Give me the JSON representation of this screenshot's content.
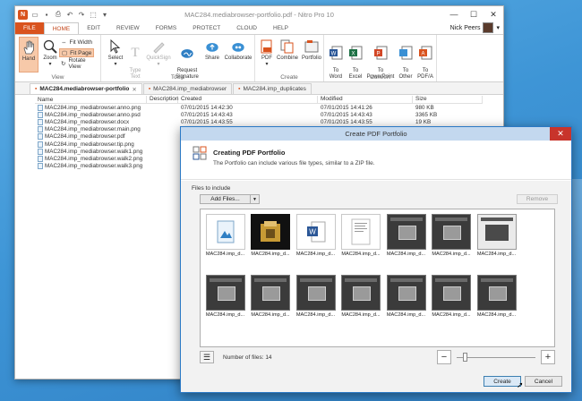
{
  "window": {
    "title": "MAC284.mediabrowser-portfolio.pdf - Nitro Pro 10",
    "controls": {
      "minimize": "—",
      "maximize": "☐",
      "close": "✕"
    }
  },
  "ribbon": {
    "tabs": [
      "FILE",
      "HOME",
      "EDIT",
      "REVIEW",
      "FORMS",
      "PROTECT",
      "CLOUD",
      "HELP"
    ],
    "active_tab": "HOME",
    "user_name": "Nick Peers",
    "groups": {
      "view": {
        "label": "View",
        "hand": "Hand",
        "zoom": "Zoom",
        "fit_width": "Fit Width",
        "fit_page": "Fit Page",
        "rotate_view": "Rotate View"
      },
      "tools": {
        "label": "Tools",
        "select": "Select",
        "type_text": "Type\nText",
        "quicksign": "QuickSign",
        "request_signature": "Request\nSignature",
        "share": "Share",
        "collaborate": "Collaborate"
      },
      "create": {
        "label": "Create",
        "pdf": "PDF",
        "combine": "Combine",
        "portfolio": "Portfolio"
      },
      "convert": {
        "label": "Convert",
        "to_word": "To\nWord",
        "to_excel": "To\nExcel",
        "to_powerpoint": "To\nPowerPoint",
        "to_other": "To\nOther",
        "to_pdfa": "To\nPDF/A"
      }
    }
  },
  "doc_tabs": [
    {
      "label": "MAC284.mediabrowser-portfolio",
      "active": true
    },
    {
      "label": "MAC284.imp_mediabrowser",
      "active": false
    },
    {
      "label": "MAC284.imp_duplicates",
      "active": false
    }
  ],
  "file_list": {
    "columns": [
      "Name",
      "Description",
      "Created",
      "Modified",
      "Size"
    ],
    "rows": [
      {
        "name": "MAC284.imp_mediabrowser.anno.png",
        "description": "",
        "created": "07/01/2015 14:42:30",
        "modified": "07/01/2015 14:41:26",
        "size": "980 KB"
      },
      {
        "name": "MAC284.imp_mediabrowser.anno.psd",
        "description": "",
        "created": "07/01/2015 14:43:43",
        "modified": "07/01/2015 14:43:43",
        "size": "3365 KB"
      },
      {
        "name": "MAC284.imp_mediabrowser.docx",
        "description": "",
        "created": "07/01/2015 14:43:55",
        "modified": "07/01/2015 14:43:55",
        "size": "19 KB"
      },
      {
        "name": "MAC284.imp_mediabrowser.main.png",
        "description": "",
        "created": "",
        "modified": "",
        "size": ""
      },
      {
        "name": "MAC284.imp_mediabrowser.pdf",
        "description": "",
        "created": "",
        "modified": "",
        "size": ""
      },
      {
        "name": "MAC284.imp_mediabrowser.tip.png",
        "description": "",
        "created": "",
        "modified": "",
        "size": ""
      },
      {
        "name": "MAC284.imp_mediabrowser.walk1.png",
        "description": "",
        "created": "",
        "modified": "",
        "size": ""
      },
      {
        "name": "MAC284.imp_mediabrowser.walk2.png",
        "description": "",
        "created": "",
        "modified": "",
        "size": ""
      },
      {
        "name": "MAC284.imp_mediabrowser.walk3.png",
        "description": "",
        "created": "",
        "modified": "",
        "size": ""
      }
    ]
  },
  "dialog": {
    "title": "Create PDF Portfolio",
    "close": "✕",
    "heading": "Creating PDF Portfolio",
    "description": "The Portfolio can include various file types, similar to a ZIP file.",
    "files_label": "Files to include",
    "add_files": "Add Files...",
    "remove": "Remove",
    "thumbnails": [
      {
        "caption": "MAC284.imp_d...",
        "kind": "doc",
        "icon": "image-file-icon"
      },
      {
        "caption": "MAC284.imp_d...",
        "kind": "selected",
        "icon": "photoshop-file-icon"
      },
      {
        "caption": "MAC284.imp_d...",
        "kind": "doc",
        "icon": "word-file-icon"
      },
      {
        "caption": "MAC284.imp_d...",
        "kind": "doc",
        "icon": "pdf-page-icon"
      },
      {
        "caption": "MAC284.imp_d...",
        "kind": "shot",
        "icon": "screenshot-icon"
      },
      {
        "caption": "MAC284.imp_d...",
        "kind": "shot",
        "icon": "screenshot-icon"
      },
      {
        "caption": "MAC284.imp_d...",
        "kind": "light",
        "icon": "screenshot-icon"
      },
      {
        "caption": "MAC284.imp_d...",
        "kind": "shot",
        "icon": "screenshot-icon"
      },
      {
        "caption": "MAC284.imp_d...",
        "kind": "shot",
        "icon": "screenshot-icon"
      },
      {
        "caption": "MAC284.imp_d...",
        "kind": "shot",
        "icon": "screenshot-icon"
      },
      {
        "caption": "MAC284.imp_d...",
        "kind": "shot",
        "icon": "screenshot-icon"
      },
      {
        "caption": "MAC284.imp_d...",
        "kind": "shot",
        "icon": "screenshot-icon"
      },
      {
        "caption": "MAC284.imp_d...",
        "kind": "shot",
        "icon": "screenshot-icon"
      },
      {
        "caption": "MAC284.imp_d...",
        "kind": "shot",
        "icon": "screenshot-icon"
      }
    ],
    "number_of_files": "Number of files: 14",
    "zoom_minus": "−",
    "zoom_plus": "+",
    "zoom_level": 0.08,
    "create": "Create",
    "cancel": "Cancel"
  },
  "colors": {
    "accent": "#d9531e",
    "dialog_border": "#2b79c5",
    "desktop": "#3e95d6"
  }
}
